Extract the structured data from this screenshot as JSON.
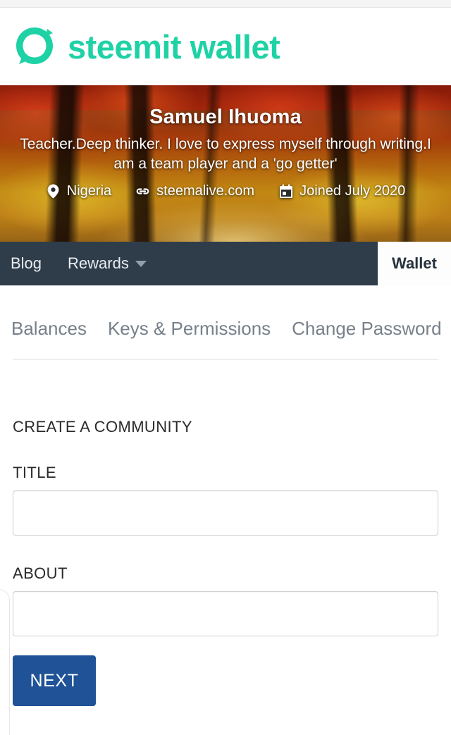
{
  "brand": {
    "logo_icon": "steemit-speech-bubble-logo",
    "name": "steemit wallet",
    "accent_color": "#1fd2a5"
  },
  "profile": {
    "name": "Samuel Ihuoma",
    "about": "Teacher.Deep thinker. I love to express myself through writing.I am a team player and a 'go getter'",
    "meta": [
      {
        "icon": "location-pin-icon",
        "label": "Nigeria"
      },
      {
        "icon": "link-icon",
        "label": "steemalive.com"
      },
      {
        "icon": "calendar-icon",
        "label": "Joined July 2020"
      }
    ]
  },
  "navbar": {
    "background_color": "#2f3d4a",
    "items": [
      {
        "label": "Blog",
        "has_caret": false
      },
      {
        "label": "Rewards",
        "has_caret": true
      }
    ],
    "active_item": {
      "label": "Wallet"
    }
  },
  "subtabs": {
    "items": [
      {
        "label": "Balances",
        "active": false
      },
      {
        "label": "Keys & Permissions",
        "active": false
      },
      {
        "label": "Change Password",
        "active": false
      }
    ]
  },
  "form": {
    "heading": "CREATE A COMMUNITY",
    "fields": [
      {
        "label": "TITLE",
        "value": "",
        "placeholder": ""
      },
      {
        "label": "ABOUT",
        "value": "",
        "placeholder": ""
      }
    ],
    "submit": {
      "label": "NEXT",
      "color": "#1f5296"
    }
  }
}
